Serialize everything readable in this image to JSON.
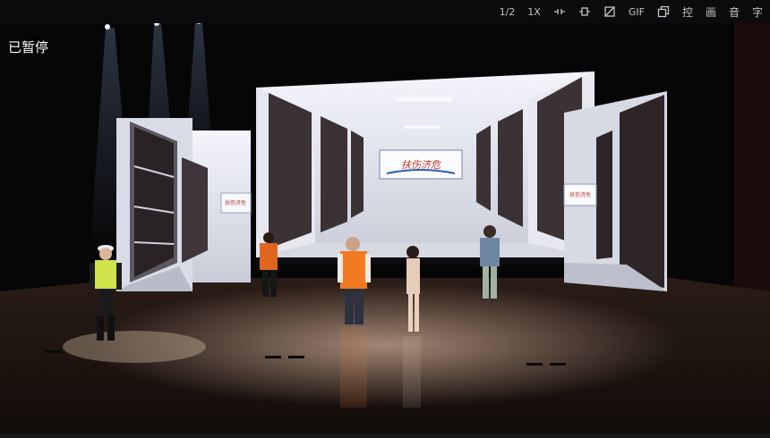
{
  "player": {
    "status_text": "已暂停",
    "toolbar": {
      "frame_label": "1/2",
      "speed_label": "1X",
      "gif_label": "GIF",
      "control_label": "控",
      "picture_label": "画",
      "audio_label": "音",
      "subtitle_label": "字"
    },
    "progress": 0
  },
  "scene": {
    "screen_sign_main": "扶伤济危",
    "screen_sign_side": "扶伤济危"
  }
}
